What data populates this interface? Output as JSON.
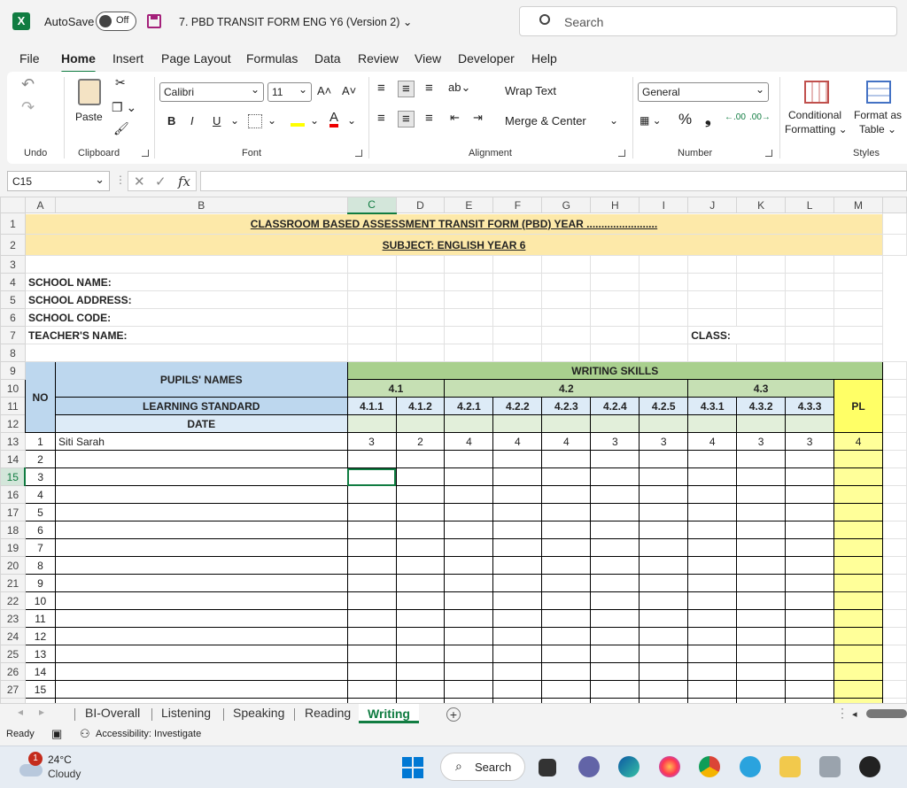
{
  "titlebar": {
    "autosave_label": "AutoSave",
    "autosave_state": "Off",
    "doc_title": "7. PBD TRANSIT FORM ENG Y6 (Version 2) ⌄",
    "search_placeholder": "Search"
  },
  "menu": [
    "File",
    "Home",
    "Insert",
    "Page Layout",
    "Formulas",
    "Data",
    "Review",
    "View",
    "Developer",
    "Help"
  ],
  "ribbon": {
    "groups": [
      "Undo",
      "Clipboard",
      "Font",
      "Alignment",
      "Number",
      "Styles"
    ],
    "paste_label": "Paste",
    "font_name": "Calibri",
    "font_size": "11",
    "wrap_text": "Wrap Text",
    "merge_center": "Merge & Center",
    "number_format": "General",
    "conditional_formatting_1": "Conditional",
    "conditional_formatting_2": "Formatting ⌄",
    "format_table_1": "Format as",
    "format_table_2": "Table ⌄",
    "bold": "B",
    "italic": "I",
    "underline": "U",
    "percent": "%",
    "comma": "❟",
    "font_grow": "A˄",
    "font_shrink": "A˅"
  },
  "formula_bar": {
    "name_box": "C15",
    "fx": "fx",
    "formula": ""
  },
  "columns": [
    "A",
    "B",
    "C",
    "D",
    "E",
    "F",
    "G",
    "H",
    "I",
    "J",
    "K",
    "L",
    "M"
  ],
  "sheet": {
    "title1": "CLASSROOM BASED ASSESSMENT TRANSIT FORM (PBD) YEAR ........................",
    "title2": "SUBJECT: ENGLISH YEAR 6",
    "school_name": "SCHOOL NAME:",
    "school_address": "SCHOOL ADDRESS:",
    "school_code": "SCHOOL CODE:",
    "teacher_name": "TEACHER'S NAME:",
    "class_label": "CLASS:",
    "no_label": "NO",
    "pupils_names": "PUPILS' NAMES",
    "learning_standard": "LEARNING STANDARD",
    "date_label": "DATE",
    "writing_skills": "WRITING SKILLS",
    "pl_label": "PL",
    "groups": [
      "4.1",
      "4.2",
      "4.3"
    ],
    "standards": [
      "4.1.1",
      "4.1.2",
      "4.2.1",
      "4.2.2",
      "4.2.3",
      "4.2.4",
      "4.2.5",
      "4.3.1",
      "4.3.2",
      "4.3.3"
    ],
    "pupils": [
      {
        "no": "1",
        "name": "Siti Sarah",
        "scores": [
          "3",
          "2",
          "4",
          "4",
          "4",
          "3",
          "3",
          "4",
          "3",
          "3"
        ],
        "pl": "4"
      }
    ],
    "row_numbers": [
      "1",
      "2",
      "3",
      "4",
      "5",
      "6",
      "7",
      "8",
      "9",
      "10",
      "11",
      "12",
      "13",
      "14",
      "15",
      "16",
      "17",
      "18",
      "19",
      "20",
      "21",
      "22",
      "23",
      "24",
      "25",
      "26",
      "27"
    ],
    "list_numbers": [
      "2",
      "3",
      "4",
      "5",
      "6",
      "7",
      "8",
      "9",
      "10",
      "11",
      "12",
      "13",
      "14",
      "15"
    ]
  },
  "tabs": [
    "BI-Overall",
    "Listening",
    "Speaking",
    "Reading",
    "Writing"
  ],
  "active_tab": "Writing",
  "status": {
    "ready": "Ready",
    "accessibility": "Accessibility: Investigate"
  },
  "taskbar": {
    "temp": "24°C",
    "weather": "Cloudy",
    "badge": "1",
    "search": "Search"
  }
}
